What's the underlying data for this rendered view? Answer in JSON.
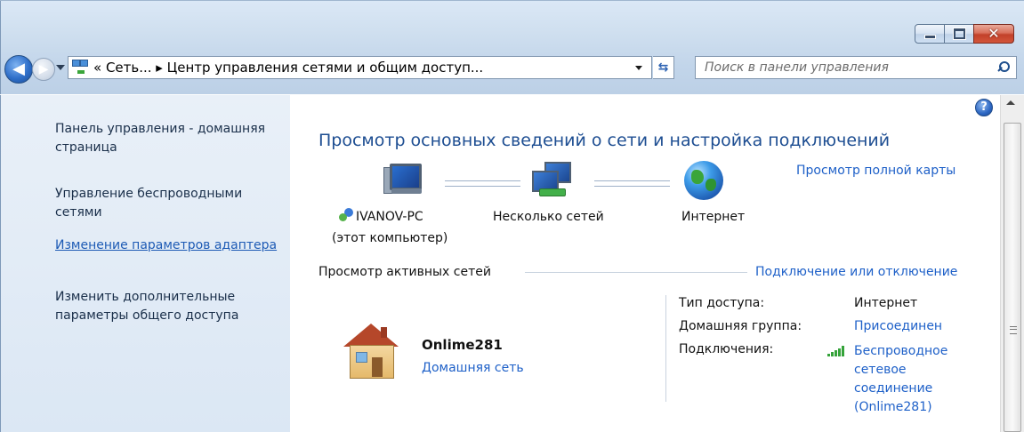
{
  "window": {
    "caption_buttons": {
      "minimize": "—",
      "maximize": "□",
      "close": "✕"
    }
  },
  "navigation": {
    "back_icon": "back-arrow-icon",
    "forward_icon": "forward-arrow-icon",
    "address_path": "« Сеть... ▸ Центр управления сетями и общим доступ...",
    "search_placeholder": "Поиск в панели управления"
  },
  "sidebar": {
    "items": [
      {
        "label": "Панель управления - домашняя страница",
        "is_link_style": false
      },
      {
        "label": "Управление беспроводными сетями",
        "is_link_style": false
      },
      {
        "label": "Изменение параметров адаптера",
        "is_link_style": true
      },
      {
        "label": "Изменить дополнительные параметры общего доступа",
        "is_link_style": false
      }
    ]
  },
  "main": {
    "heading": "Просмотр основных сведений о сети и настройка подключений",
    "full_map_link": "Просмотр полной карты",
    "map_nodes": [
      {
        "label": "IVANOV-PC",
        "sublabel": "(этот компьютер)",
        "icon": "computer-icon"
      },
      {
        "label": "Несколько сетей",
        "icon": "multiple-networks-icon"
      },
      {
        "label": "Интернет",
        "icon": "globe-icon"
      }
    ],
    "active_networks_label": "Просмотр активных сетей",
    "connect_disconnect_link": "Подключение или отключение",
    "network": {
      "name": "Onlime281",
      "type": "Домашняя сеть",
      "icon": "home-network-icon"
    },
    "properties": [
      {
        "label": "Тип доступа:",
        "value": "Интернет"
      },
      {
        "label": "Домашняя группа:",
        "value": "Присоединен"
      },
      {
        "label": "Подключения:",
        "value": "Беспроводное сетевое соединение (Onlime281)"
      }
    ]
  },
  "colors": {
    "link": "#1e60c8",
    "heading": "#1e4e92",
    "sidebar_bg": "#dbe7f4"
  }
}
